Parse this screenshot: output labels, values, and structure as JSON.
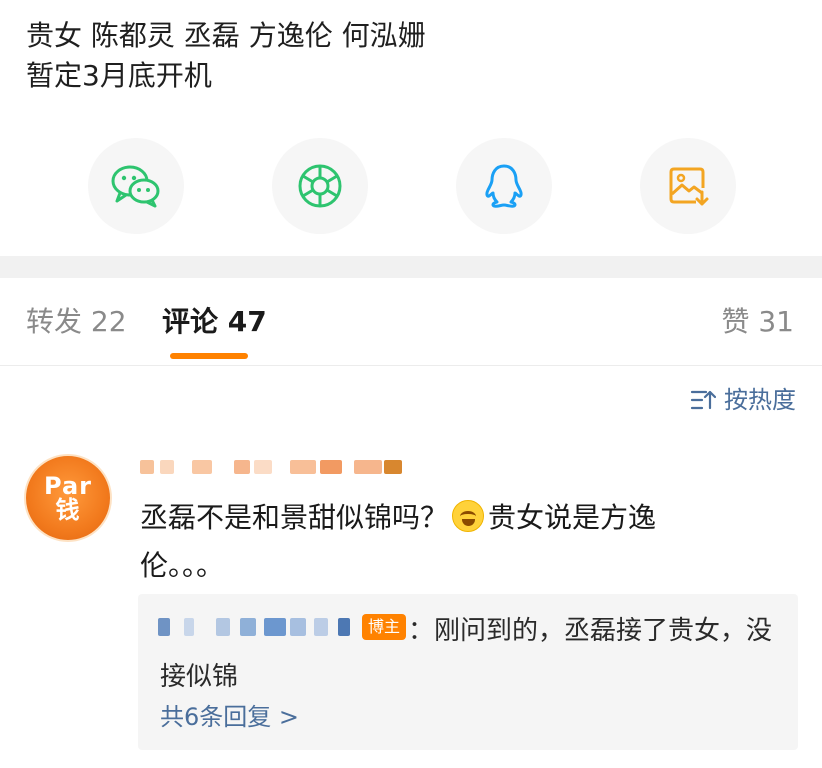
{
  "post": {
    "line1": "贵女 陈都灵 丞磊 方逸伦 何泓姗",
    "line2": "暂定3月底开机"
  },
  "share": [
    {
      "icon": "wechat-icon",
      "color": "#2ec46f"
    },
    {
      "icon": "moments-icon",
      "color": "#2ec46f"
    },
    {
      "icon": "qq-icon",
      "color": "#1aa0f5"
    },
    {
      "icon": "save-image-icon",
      "color": "#f3a522"
    }
  ],
  "tabs": {
    "repost": "转发 22",
    "comments": "评论 47",
    "likes": "赞 31"
  },
  "sort": {
    "label": "按热度"
  },
  "comment": {
    "avatar_text": "Par\n钱",
    "text_before_emoji": "丞磊不是和景甜似锦吗？",
    "text_after_emoji": "贵女说是方逸伦。。。",
    "emoji": "laughing-crying-emoji"
  },
  "reply": {
    "badge": "博主",
    "text": "：刚问到的，丞磊接了贵女，没接似锦",
    "more": "共6条回复 >"
  },
  "colors": {
    "accent": "#ff8200",
    "link": "#4a6e9b"
  }
}
